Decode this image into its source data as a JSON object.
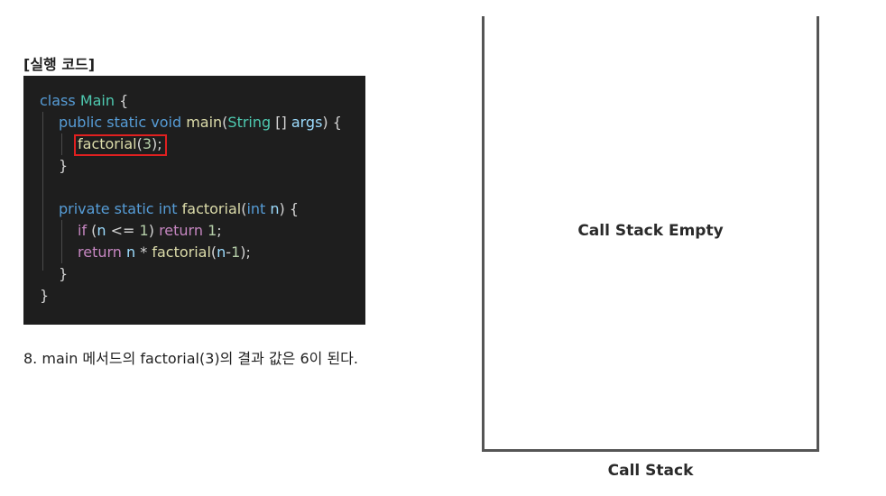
{
  "section_label": "[실행 코드]",
  "code": {
    "lines": [
      [
        {
          "t": "class ",
          "c": "#569cd6"
        },
        {
          "t": "Main",
          "c": "#4ec9b0"
        },
        {
          "t": " {",
          "c": "#d4d4d4"
        }
      ],
      [
        {
          "t": "public static void ",
          "c": "#569cd6"
        },
        {
          "t": "main",
          "c": "#dcdcaa"
        },
        {
          "t": "(",
          "c": "#d4d4d4"
        },
        {
          "t": "String",
          "c": "#4ec9b0"
        },
        {
          "t": " [] ",
          "c": "#d4d4d4"
        },
        {
          "t": "args",
          "c": "#9cdcfe"
        },
        {
          "t": ") {",
          "c": "#d4d4d4"
        }
      ],
      [
        {
          "t": "factorial",
          "c": "#dcdcaa"
        },
        {
          "t": "(",
          "c": "#d4d4d4"
        },
        {
          "t": "3",
          "c": "#b5cea8"
        },
        {
          "t": ");",
          "c": "#d4d4d4"
        }
      ],
      [
        {
          "t": "}",
          "c": "#d4d4d4"
        }
      ],
      [],
      [
        {
          "t": "private static int ",
          "c": "#569cd6"
        },
        {
          "t": "factorial",
          "c": "#dcdcaa"
        },
        {
          "t": "(",
          "c": "#d4d4d4"
        },
        {
          "t": "int ",
          "c": "#569cd6"
        },
        {
          "t": "n",
          "c": "#9cdcfe"
        },
        {
          "t": ") {",
          "c": "#d4d4d4"
        }
      ],
      [
        {
          "t": "if ",
          "c": "#c586c0"
        },
        {
          "t": "(",
          "c": "#d4d4d4"
        },
        {
          "t": "n",
          "c": "#9cdcfe"
        },
        {
          "t": " <= ",
          "c": "#d4d4d4"
        },
        {
          "t": "1",
          "c": "#b5cea8"
        },
        {
          "t": ") ",
          "c": "#d4d4d4"
        },
        {
          "t": "return ",
          "c": "#c586c0"
        },
        {
          "t": "1",
          "c": "#b5cea8"
        },
        {
          "t": ";",
          "c": "#d4d4d4"
        }
      ],
      [
        {
          "t": "return ",
          "c": "#c586c0"
        },
        {
          "t": "n",
          "c": "#9cdcfe"
        },
        {
          "t": " * ",
          "c": "#d4d4d4"
        },
        {
          "t": "factorial",
          "c": "#dcdcaa"
        },
        {
          "t": "(",
          "c": "#d4d4d4"
        },
        {
          "t": "n",
          "c": "#9cdcfe"
        },
        {
          "t": "-",
          "c": "#d4d4d4"
        },
        {
          "t": "1",
          "c": "#b5cea8"
        },
        {
          "t": ");",
          "c": "#d4d4d4"
        }
      ],
      [
        {
          "t": "}",
          "c": "#d4d4d4"
        }
      ],
      [
        {
          "t": "}",
          "c": "#d4d4d4"
        }
      ]
    ]
  },
  "caption": "8. main 메서드의 factorial(3)의 결과 값은 6이 된다.",
  "call_stack": {
    "empty_text": "Call Stack Empty",
    "label": "Call Stack"
  },
  "colors": {
    "code_background": "#1e1e1e",
    "highlight_border": "#e02020",
    "stack_border": "#555555"
  }
}
